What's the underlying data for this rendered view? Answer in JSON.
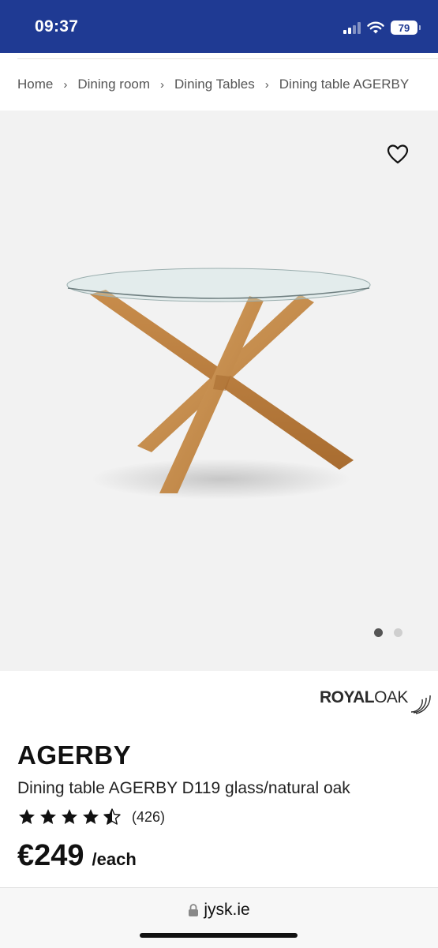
{
  "status_bar": {
    "time": "09:37",
    "battery": "79"
  },
  "breadcrumb": {
    "items": [
      "Home",
      "Dining room",
      "Dining Tables",
      "Dining table AGERBY"
    ],
    "separator": "›"
  },
  "gallery": {
    "slide_count": 2,
    "active_index": 0
  },
  "brand": {
    "part1": "ROYAL",
    "part2": "OAK"
  },
  "product": {
    "name": "AGERBY",
    "description": "Dining table AGERBY D119 glass/natural oak",
    "rating": 4.5,
    "review_count": "(426)",
    "price": "€249",
    "unit": "/each"
  },
  "browser": {
    "url": "jysk.ie"
  },
  "colors": {
    "header_blue": "#1f3a93",
    "oak": "#c58a4a"
  }
}
